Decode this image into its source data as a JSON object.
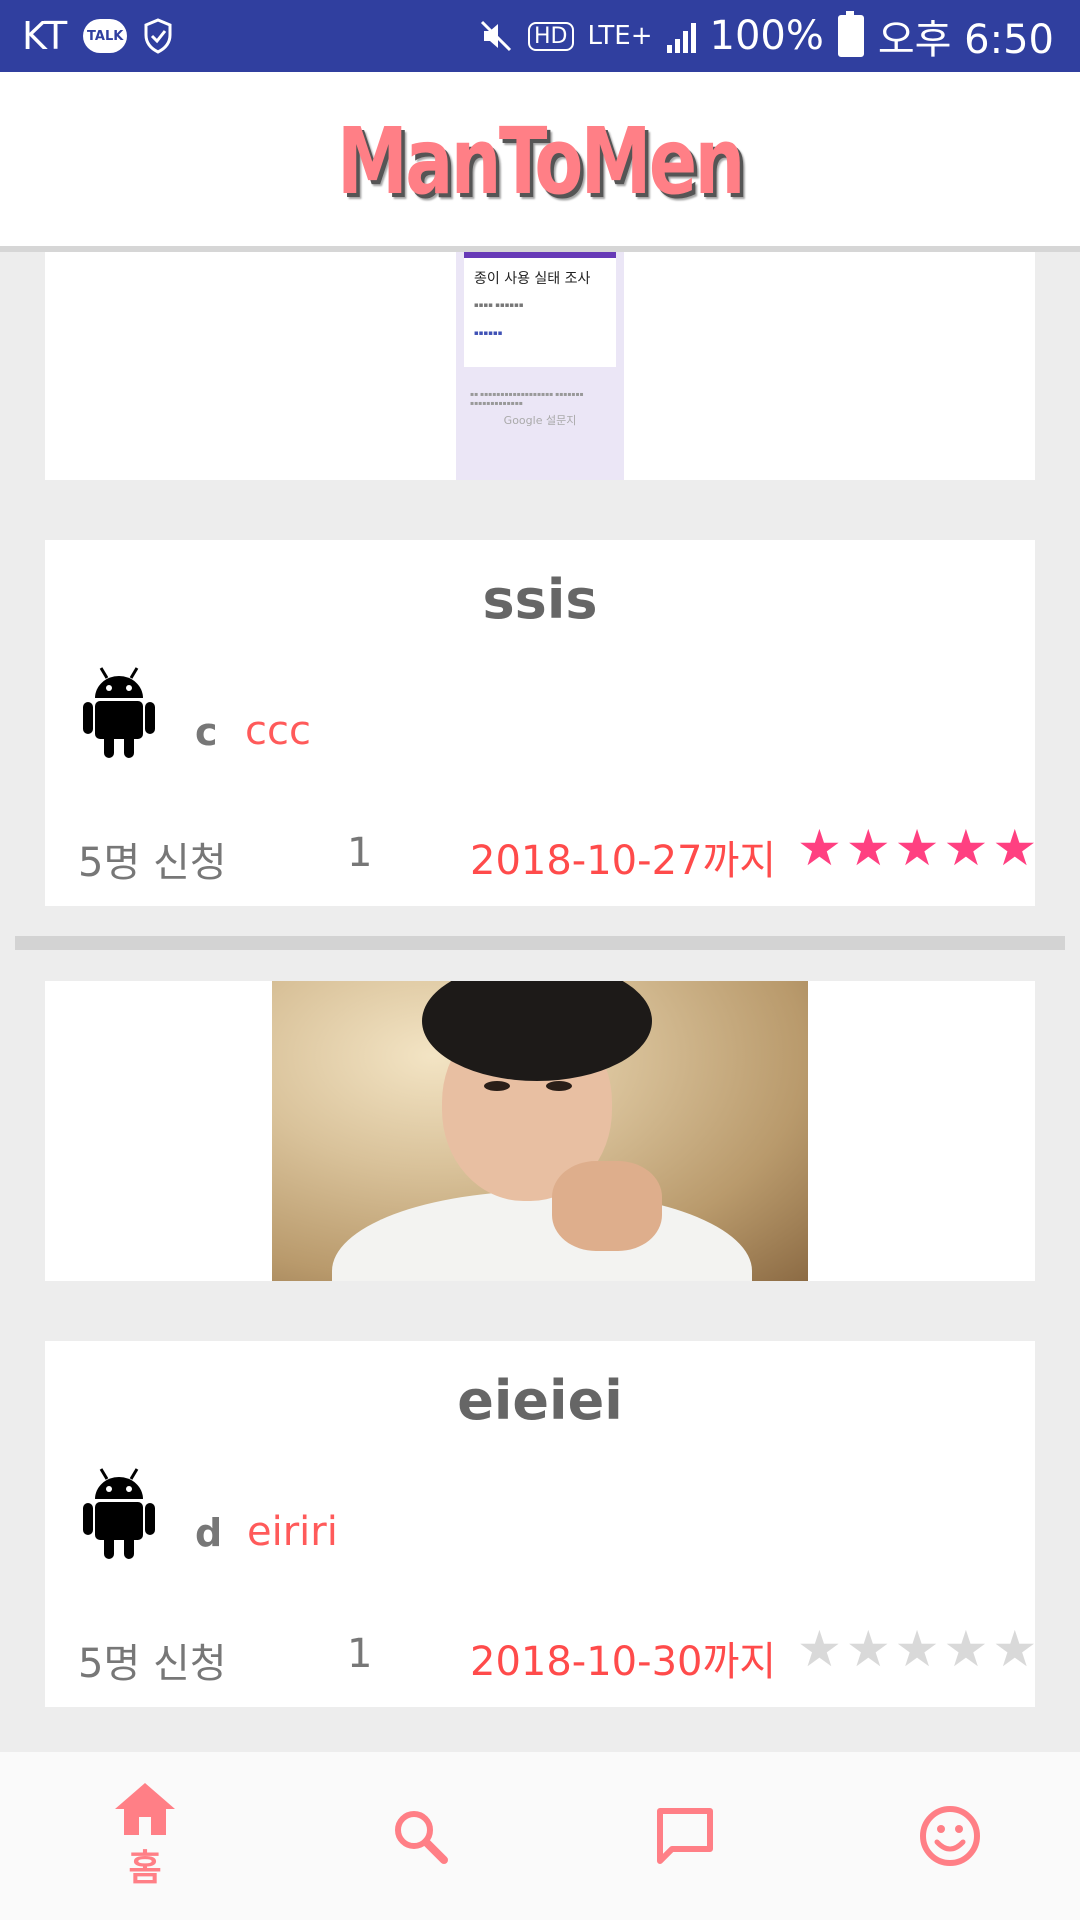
{
  "status_bar": {
    "carrier": "KT",
    "talk_badge": "TALK",
    "hd": "HD",
    "network": "LTE+",
    "battery": "100%",
    "time": "오후 6:50"
  },
  "app": {
    "logo": "ManToMen"
  },
  "form_thumbnail": {
    "title": "종이 사용 실태 조사",
    "google_label": "Google 설문지"
  },
  "posts": [
    {
      "title": "ssis",
      "writer": "c",
      "nickname": "ccc",
      "applicants": "5명 신청",
      "count": "1",
      "deadline": "2018-10-27까지",
      "rating": 5
    },
    {
      "title": "eieiei",
      "writer": "d",
      "nickname": "eiriri",
      "applicants": "5명 신청",
      "count": "1",
      "deadline": "2018-10-30까지",
      "rating": 0
    }
  ],
  "bottom_nav": {
    "home_label": "홈"
  },
  "colors": {
    "status_bar": "#303f9f",
    "accent": "#ff7f86",
    "star_on": "#ff4081",
    "star_off": "#d9d9d9",
    "deadline": "#ff4b4b"
  },
  "icons": {
    "home": "home-icon",
    "search": "search-icon",
    "chat": "chat-icon",
    "profile": "smiley-icon",
    "author": "android-icon"
  }
}
